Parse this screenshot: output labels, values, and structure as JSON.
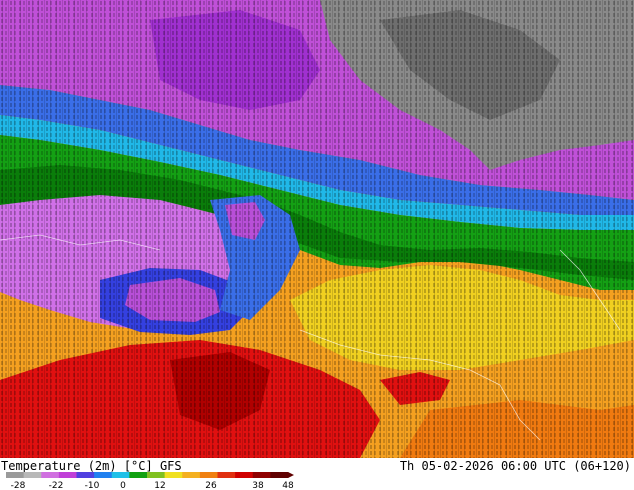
{
  "map": {
    "colors": {
      "deep_cold": "#6e6e6e",
      "cold_gray": "#9a9a9a",
      "purple": "#b64fd8",
      "magenta": "#d86ee8",
      "violet": "#9e2fd0",
      "blue": "#3440e0",
      "light_blue": "#2e8cf0",
      "cyan": "#20c8e8",
      "green": "#1aa01a",
      "dark_green": "#0a7d0a",
      "yellow": "#f0d020",
      "orange": "#f4a020",
      "dark_orange": "#f07a10",
      "red": "#e01010",
      "dark_red": "#b00000"
    }
  },
  "footer": {
    "title": "Temperature (2m) [°C] GFS",
    "datetime": "Th 05-02-2026 06:00 UTC (06+120)",
    "scale": {
      "colors": [
        "#9a9a9a",
        "#b8b8b8",
        "#d070e0",
        "#c040d8",
        "#5040e0",
        "#2080f0",
        "#20c0e8",
        "#10a010",
        "#80c020",
        "#f0e020",
        "#f4b020",
        "#f08010",
        "#e03010",
        "#d00000",
        "#900000",
        "#600000"
      ],
      "ticks": [
        "-28",
        "-22",
        "-10",
        "0",
        "12",
        "26",
        "38",
        "48"
      ]
    }
  }
}
